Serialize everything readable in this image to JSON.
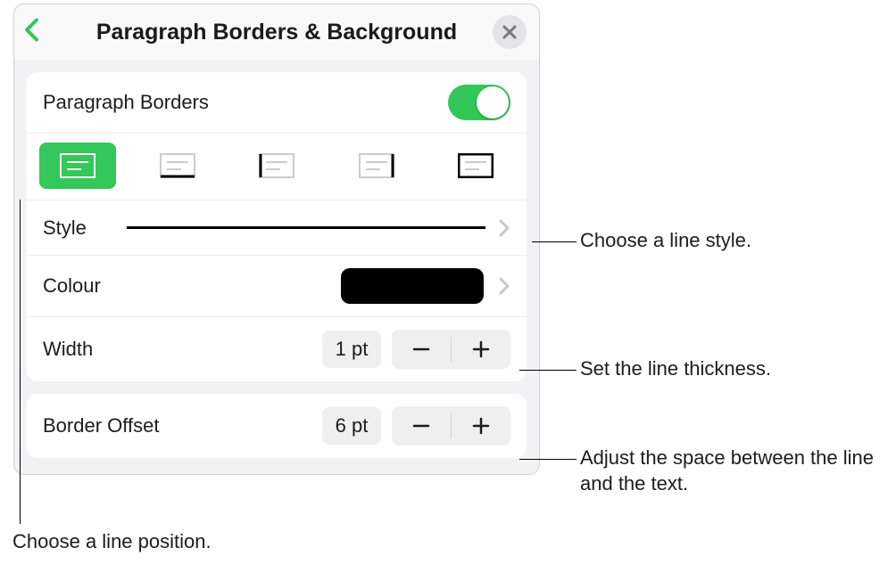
{
  "header": {
    "title": "Paragraph Borders & Background"
  },
  "paragraph_borders": {
    "label": "Paragraph Borders",
    "enabled": true
  },
  "positions": {
    "selected_index": 0,
    "items": [
      "border-all",
      "border-bottom",
      "border-left",
      "border-right",
      "border-surround"
    ]
  },
  "style": {
    "label": "Style"
  },
  "colour": {
    "label": "Colour",
    "value_hex": "#000000"
  },
  "width": {
    "label": "Width",
    "value": "1 pt"
  },
  "border_offset": {
    "label": "Border Offset",
    "value": "6 pt"
  },
  "callouts": {
    "style": "Choose a line style.",
    "width": "Set the line thickness.",
    "offset": "Adjust the space between the line and the text.",
    "position": "Choose a line position."
  }
}
